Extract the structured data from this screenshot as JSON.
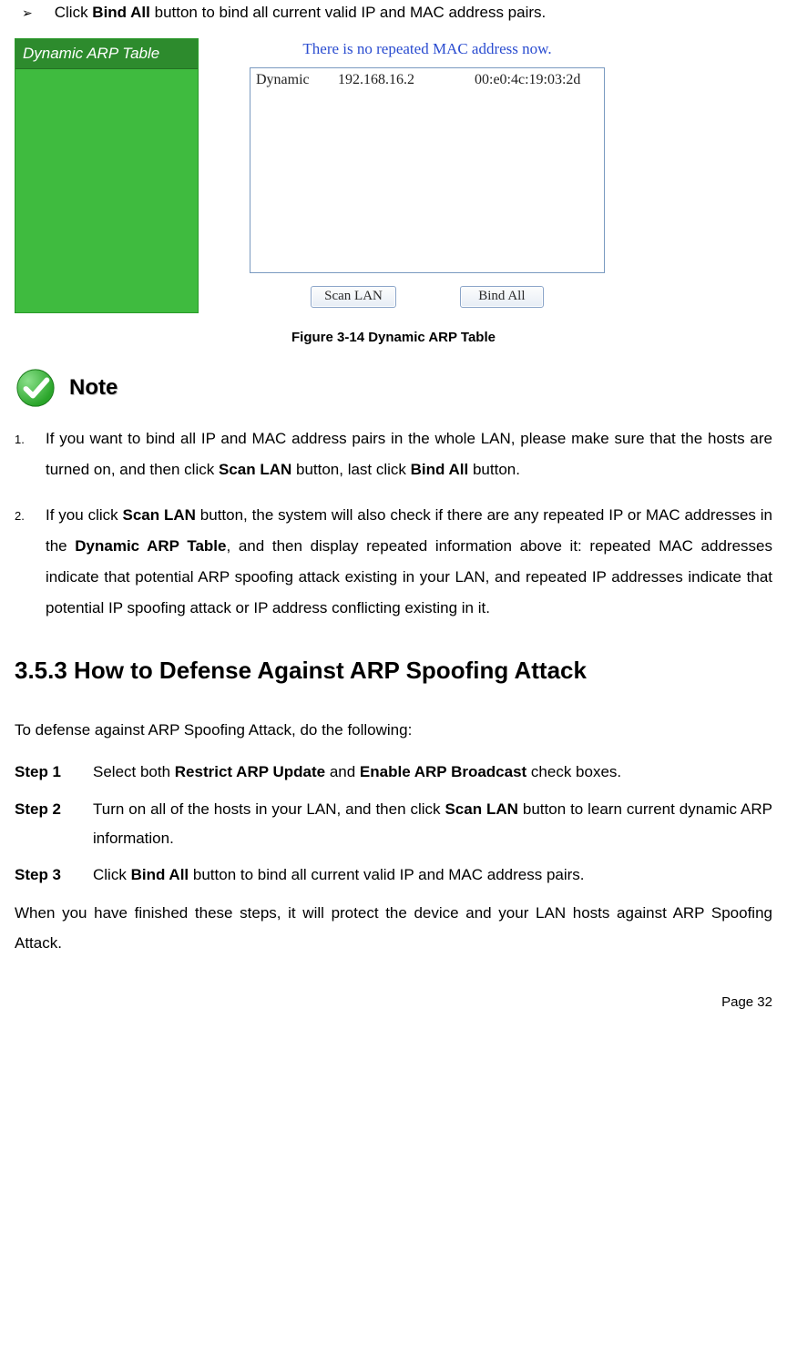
{
  "top_bullet": {
    "arrow": "➢",
    "pre": "Click ",
    "bold": "Bind All",
    "post": " button to bind all current valid IP and MAC address pairs."
  },
  "figure": {
    "sidebar_title": "Dynamic ARP Table",
    "status_message": "There is no repeated MAC address now.",
    "row": {
      "type": "Dynamic",
      "ip": "192.168.16.2",
      "mac": "00:e0:4c:19:03:2d"
    },
    "buttons": {
      "scan": "Scan LAN",
      "bind": "Bind All"
    },
    "caption": "Figure 3-14 Dynamic ARP Table"
  },
  "note_label": "Note",
  "notes": [
    {
      "num": "1.",
      "parts": [
        {
          "t": "If you want to bind all IP and MAC address pairs in the whole LAN, please make sure that the hosts are turned on, and then click "
        },
        {
          "b": "Scan LAN"
        },
        {
          "t": " button, last click "
        },
        {
          "b": "Bind All"
        },
        {
          "t": " button."
        }
      ]
    },
    {
      "num": "2.",
      "parts": [
        {
          "t": "If you click "
        },
        {
          "b": "Scan LAN"
        },
        {
          "t": " button, the system will also check if there are any repeated IP or MAC addresses in the "
        },
        {
          "b": "Dynamic ARP Table"
        },
        {
          "t": ", and then display repeated information above it: repeated MAC addresses indicate that potential ARP spoofing attack existing in your LAN, and repeated IP addresses indicate that potential IP spoofing attack or IP address conflicting existing in it."
        }
      ]
    }
  ],
  "section_heading": "3.5.3    How to Defense Against ARP Spoofing Attack",
  "intro": "To defense against ARP Spoofing Attack, do the following:",
  "steps": [
    {
      "label": "Step 1",
      "parts": [
        {
          "t": "Select both "
        },
        {
          "b": "Restrict ARP Update"
        },
        {
          "t": " and "
        },
        {
          "b": "Enable ARP Broadcast"
        },
        {
          "t": " check boxes."
        }
      ]
    },
    {
      "label": "Step 2",
      "parts": [
        {
          "t": "Turn on all of the hosts in your LAN, and then click "
        },
        {
          "b": "Scan LAN"
        },
        {
          "t": " button to learn current dynamic ARP information."
        }
      ]
    },
    {
      "label": "Step 3",
      "parts": [
        {
          "t": "Click "
        },
        {
          "b": "Bind All"
        },
        {
          "t": " button to bind all current valid IP and MAC address pairs."
        }
      ]
    }
  ],
  "outro": "When you have finished these steps, it will protect the device and your LAN hosts against ARP Spoofing Attack.",
  "page_number": "Page  32"
}
